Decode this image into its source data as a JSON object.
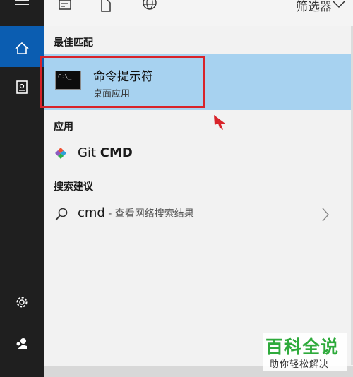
{
  "sidebar": {
    "items": [
      {
        "name": "menu-icon"
      },
      {
        "name": "home-icon",
        "selected": true
      },
      {
        "name": "documents-icon"
      },
      {
        "name": "settings-icon"
      },
      {
        "name": "user-icon"
      }
    ]
  },
  "topbar": {
    "icons": [
      "document-icon",
      "file-icon",
      "globe-icon"
    ],
    "filter_label": "筛选器"
  },
  "best_match": {
    "heading": "最佳匹配",
    "title": "命令提示符",
    "subtitle": "桌面应用",
    "icon": "command-prompt-icon",
    "icon_text": "C:\\_"
  },
  "apps": {
    "heading": "应用",
    "items": [
      {
        "prefix": "Git",
        "bold": "CMD",
        "icon": "git-icon"
      }
    ]
  },
  "suggestions": {
    "heading": "搜索建议",
    "items": [
      {
        "query": "cmd",
        "suffix": " - 查看网络搜索结果",
        "icon": "search-icon"
      }
    ]
  },
  "watermark": {
    "title": "百科全说",
    "subtitle": "助你轻松解决"
  },
  "colors": {
    "rail": "#1f1f1f",
    "selected_nav": "#0b5db1",
    "selected_result": "#a7d2f0",
    "highlight_box": "#d8232a",
    "watermark_green": "#2eaa3b"
  }
}
